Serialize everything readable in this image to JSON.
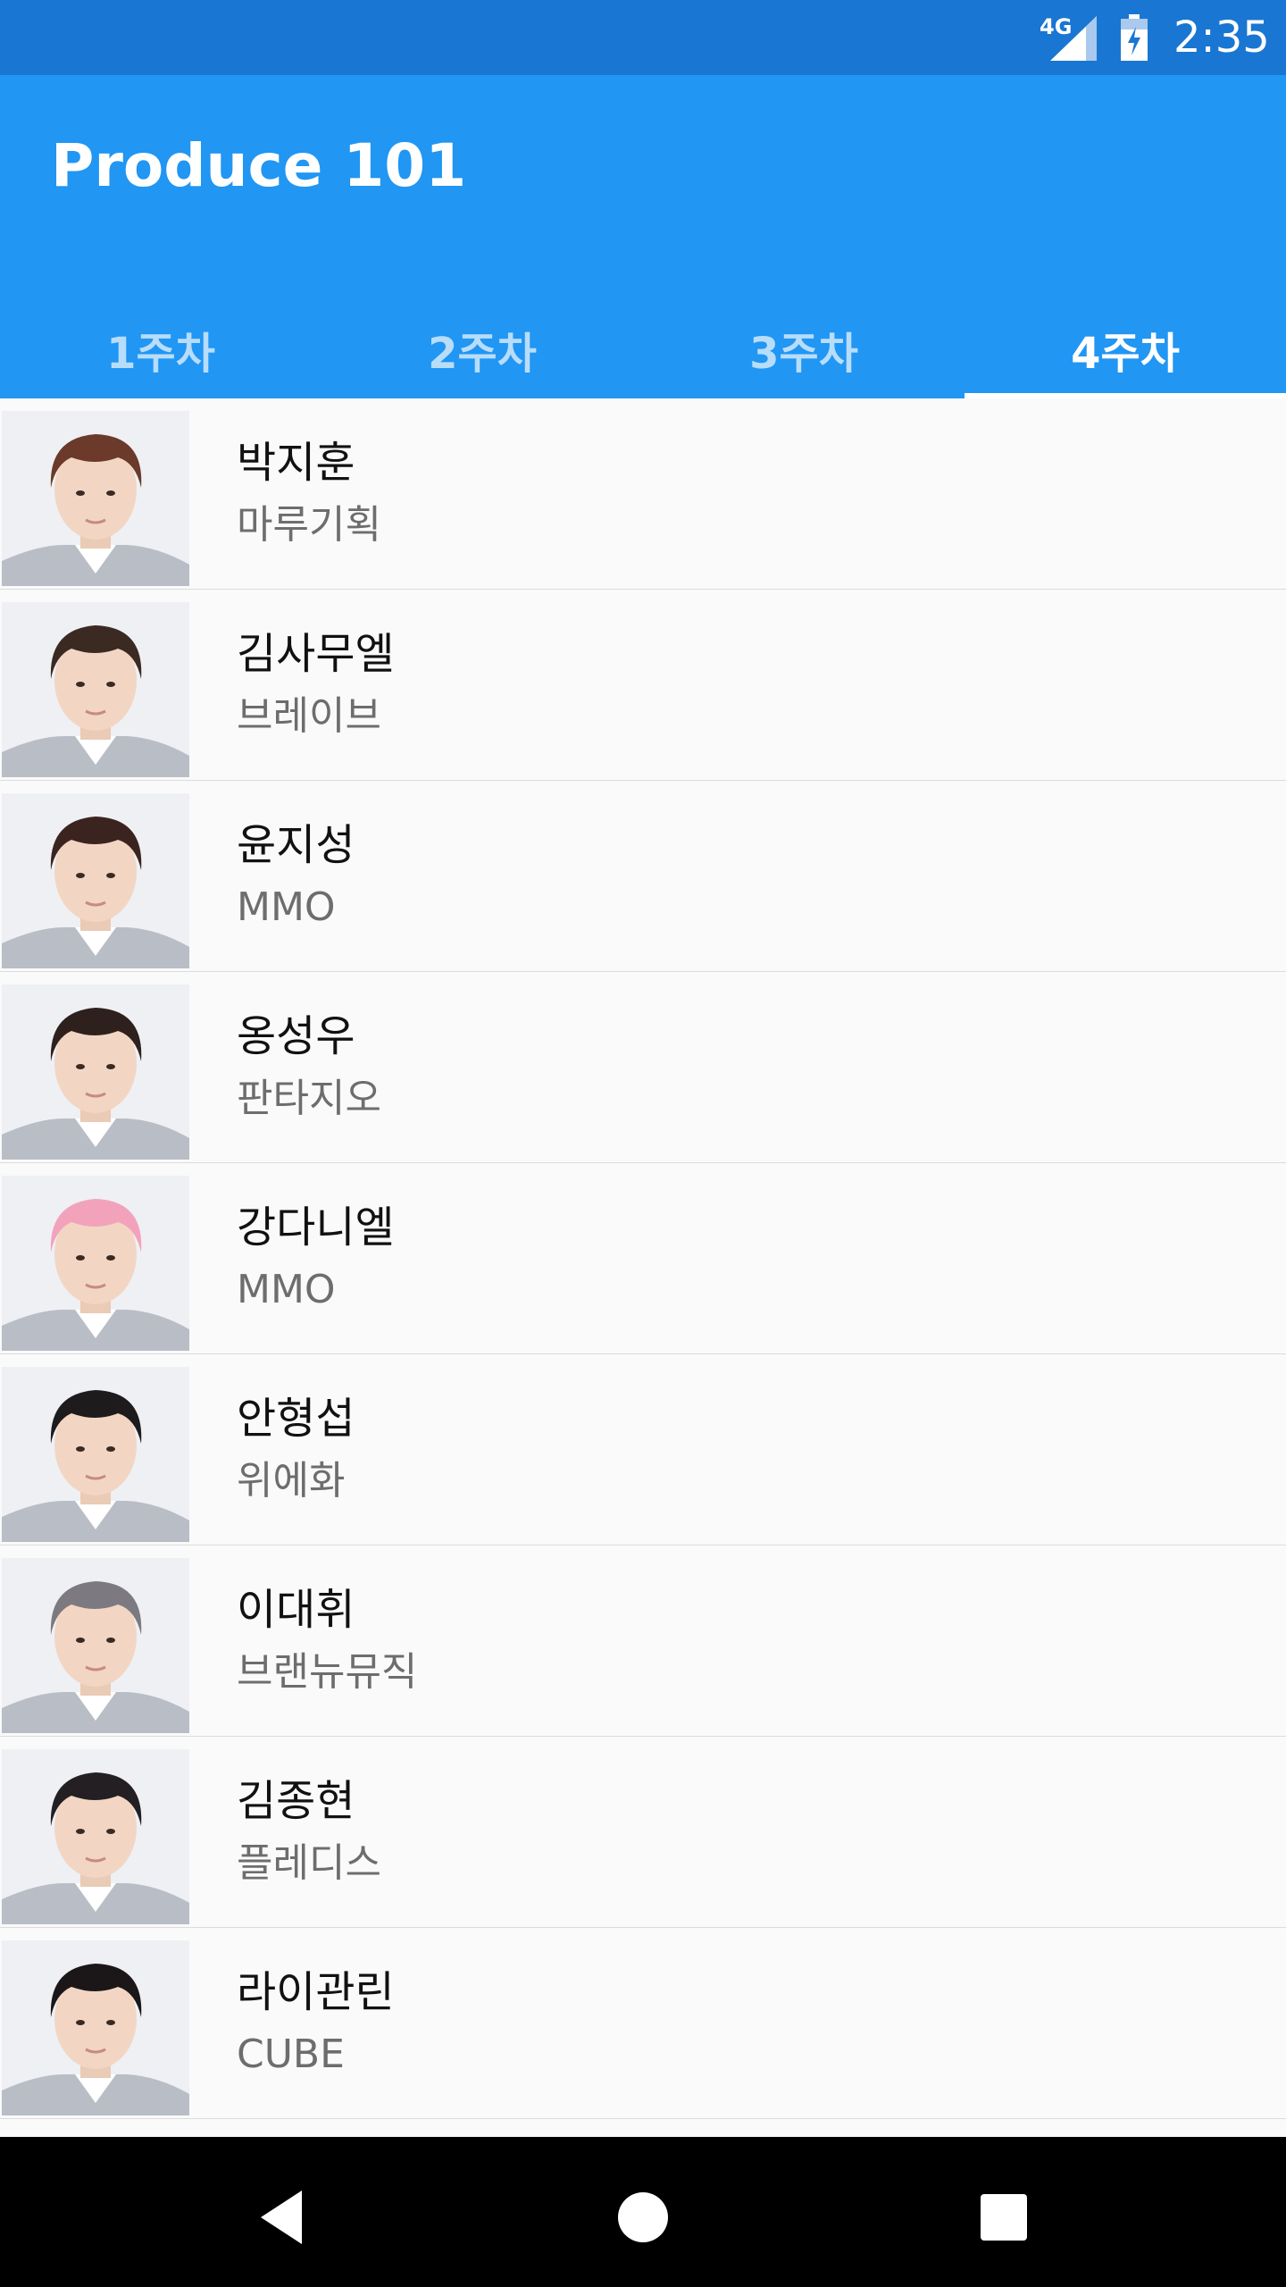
{
  "status_bar": {
    "network": "4G",
    "time": "2:35",
    "icons": [
      "signal-icon",
      "battery-charging-icon"
    ]
  },
  "app_bar": {
    "title": "Produce 101"
  },
  "tabs": [
    {
      "label": "1주차",
      "active": false
    },
    {
      "label": "2주차",
      "active": false
    },
    {
      "label": "3주차",
      "active": false
    },
    {
      "label": "4주차",
      "active": true
    }
  ],
  "trainees": [
    {
      "name": "박지훈",
      "agency": "마루기획",
      "hair": "#6b3a2a"
    },
    {
      "name": "김사무엘",
      "agency": "브레이브",
      "hair": "#3a2a22"
    },
    {
      "name": "윤지성",
      "agency": "MMO",
      "hair": "#3b2420"
    },
    {
      "name": "옹성우",
      "agency": "판타지오",
      "hair": "#2e211d"
    },
    {
      "name": "강다니엘",
      "agency": "MMO",
      "hair": "#f2a3bb"
    },
    {
      "name": "안형섭",
      "agency": "위에화",
      "hair": "#1e1b1d"
    },
    {
      "name": "이대휘",
      "agency": "브랜뉴뮤직",
      "hair": "#7c7a80"
    },
    {
      "name": "김종현",
      "agency": "플레디스",
      "hair": "#231f22"
    },
    {
      "name": "라이관린",
      "agency": "CUBE",
      "hair": "#1b1719"
    }
  ],
  "nav_bar": {
    "icons": [
      "back-icon",
      "home-icon",
      "recents-icon"
    ]
  }
}
